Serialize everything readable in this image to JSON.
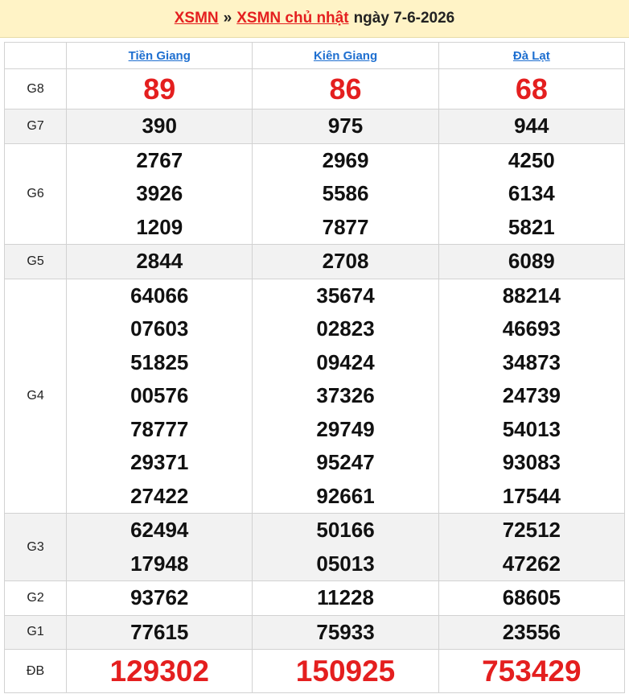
{
  "header": {
    "link1": "XSMN",
    "separator": "»",
    "link2": "XSMN chủ nhật",
    "date_text": "ngày 7-6-2026"
  },
  "provinces": [
    "Tiền Giang",
    "Kiên Giang",
    "Đà Lạt"
  ],
  "rows": [
    {
      "label": "G8",
      "style": "big",
      "alt": false,
      "values": [
        [
          "89"
        ],
        [
          "86"
        ],
        [
          "68"
        ]
      ]
    },
    {
      "label": "G7",
      "style": "num",
      "alt": true,
      "values": [
        [
          "390"
        ],
        [
          "975"
        ],
        [
          "944"
        ]
      ]
    },
    {
      "label": "G6",
      "style": "num",
      "alt": false,
      "values": [
        [
          "2767",
          "3926",
          "1209"
        ],
        [
          "2969",
          "5586",
          "7877"
        ],
        [
          "4250",
          "6134",
          "5821"
        ]
      ]
    },
    {
      "label": "G5",
      "style": "num",
      "alt": true,
      "values": [
        [
          "2844"
        ],
        [
          "2708"
        ],
        [
          "6089"
        ]
      ]
    },
    {
      "label": "G4",
      "style": "num",
      "alt": false,
      "values": [
        [
          "64066",
          "07603",
          "51825",
          "00576",
          "78777",
          "29371",
          "27422"
        ],
        [
          "35674",
          "02823",
          "09424",
          "37326",
          "29749",
          "95247",
          "92661"
        ],
        [
          "88214",
          "46693",
          "34873",
          "24739",
          "54013",
          "93083",
          "17544"
        ]
      ]
    },
    {
      "label": "G3",
      "style": "num",
      "alt": true,
      "values": [
        [
          "62494",
          "17948"
        ],
        [
          "50166",
          "05013"
        ],
        [
          "72512",
          "47262"
        ]
      ]
    },
    {
      "label": "G2",
      "style": "num",
      "alt": false,
      "values": [
        [
          "93762"
        ],
        [
          "11228"
        ],
        [
          "68605"
        ]
      ]
    },
    {
      "label": "G1",
      "style": "num",
      "alt": true,
      "values": [
        [
          "77615"
        ],
        [
          "75933"
        ],
        [
          "23556"
        ]
      ]
    },
    {
      "label": "ĐB",
      "style": "db",
      "alt": false,
      "values": [
        [
          "129302"
        ],
        [
          "150925"
        ],
        [
          "753429"
        ]
      ]
    }
  ],
  "colors": {
    "accent_red": "#e41f1f",
    "link_blue": "#1e6fd0",
    "header_bg": "#fff3c6"
  }
}
